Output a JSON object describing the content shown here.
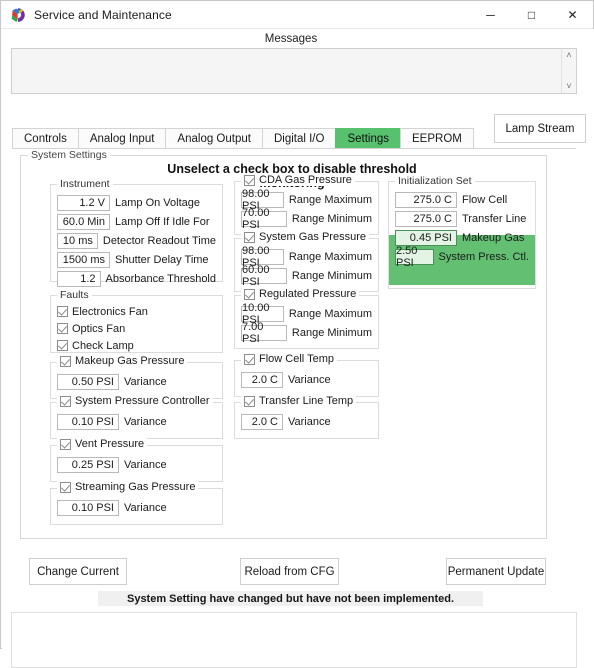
{
  "window": {
    "title": "Service and Maintenance",
    "icon": "app-logo-icon",
    "minimize": "─",
    "maximize": "□",
    "close": "✕"
  },
  "messages": {
    "label": "Messages",
    "content": "",
    "scroll_up": "˄",
    "scroll_down": "˅"
  },
  "tabs": [
    {
      "label": "Controls",
      "active": false
    },
    {
      "label": "Analog Input",
      "active": false
    },
    {
      "label": "Analog Output",
      "active": false
    },
    {
      "label": "Digital I/O",
      "active": false
    },
    {
      "label": "Settings",
      "active": true
    },
    {
      "label": "EEPROM",
      "active": false
    }
  ],
  "lamp_stream_button": "Lamp Stream",
  "system_settings": {
    "group_title": "System Settings",
    "headline": "Unselect a check box to disable threshold monitoring"
  },
  "instrument": {
    "title": "Instrument",
    "fields": [
      {
        "value": "1.2 V",
        "label": "Lamp On Voltage"
      },
      {
        "value": "60.0 Min",
        "label": "Lamp Off If Idle For"
      },
      {
        "value": "10 ms",
        "label": "Detector Readout Time"
      },
      {
        "value": "1500 ms",
        "label": "Shutter Delay Time"
      },
      {
        "value": "1.2",
        "label": "Absorbance Threshold"
      }
    ]
  },
  "faults": {
    "title": "Faults",
    "items": [
      {
        "label": "Electronics Fan",
        "checked": true
      },
      {
        "label": "Optics Fan",
        "checked": true
      },
      {
        "label": "Check Lamp",
        "checked": true
      }
    ]
  },
  "makeup_gas_pressure": {
    "title": "Makeup Gas Pressure",
    "checked": true,
    "fields": [
      {
        "value": "0.50 PSI",
        "label": "Variance"
      }
    ]
  },
  "system_pressure_controller": {
    "title": "System Pressure Controller",
    "checked": true,
    "fields": [
      {
        "value": "0.10 PSI",
        "label": "Variance"
      }
    ]
  },
  "vent_pressure": {
    "title": "Vent Pressure",
    "checked": true,
    "fields": [
      {
        "value": "0.25 PSI",
        "label": "Variance"
      }
    ]
  },
  "streaming_gas_pressure": {
    "title": "Streaming Gas Pressure",
    "checked": true,
    "fields": [
      {
        "value": "0.10 PSI",
        "label": "Variance"
      }
    ]
  },
  "cda_gas_pressure": {
    "title": "CDA Gas Pressure",
    "checked": true,
    "fields": [
      {
        "value": "98.00 PSI",
        "label": "Range Maximum"
      },
      {
        "value": "70.00 PSI",
        "label": "Range Minimum"
      }
    ]
  },
  "system_gas_pressure": {
    "title": "System Gas Pressure",
    "checked": true,
    "fields": [
      {
        "value": "98.00 PSI",
        "label": "Range Maximum"
      },
      {
        "value": "60.00 PSI",
        "label": "Range Minimum"
      }
    ]
  },
  "regulated_pressure": {
    "title": "Regulated Pressure",
    "checked": true,
    "fields": [
      {
        "value": "10.00 PSI",
        "label": "Range Maximum"
      },
      {
        "value": "7.00 PSI",
        "label": "Range Minimum"
      }
    ]
  },
  "flow_cell_temp": {
    "title": "Flow Cell Temp",
    "checked": true,
    "fields": [
      {
        "value": "2.0 C",
        "label": "Variance"
      }
    ]
  },
  "transfer_line_temp": {
    "title": "Transfer Line Temp",
    "checked": true,
    "fields": [
      {
        "value": "2.0 C",
        "label": "Variance"
      }
    ]
  },
  "initialization_set": {
    "title": "Initialization Set",
    "fields": [
      {
        "value": "275.0 C",
        "label": "Flow Cell",
        "highlighted": false
      },
      {
        "value": "275.0 C",
        "label": "Transfer Line",
        "highlighted": false
      },
      {
        "value": "0.45 PSI",
        "label": "Makeup Gas",
        "highlighted": true
      },
      {
        "value": "2.50 PSI",
        "label": "System Press. Ctl.",
        "highlighted": true
      }
    ]
  },
  "buttons": {
    "change_current": "Change Current",
    "reload_from_cfg": "Reload from CFG",
    "permanent_update": "Permanent Update"
  },
  "status_message": "System Setting have changed but have not been implemented.",
  "colors": {
    "accent_green": "#58c16e",
    "highlight_green": "#63bf72",
    "status_band": "#f0f0f0",
    "border": "#cfcfcf"
  }
}
